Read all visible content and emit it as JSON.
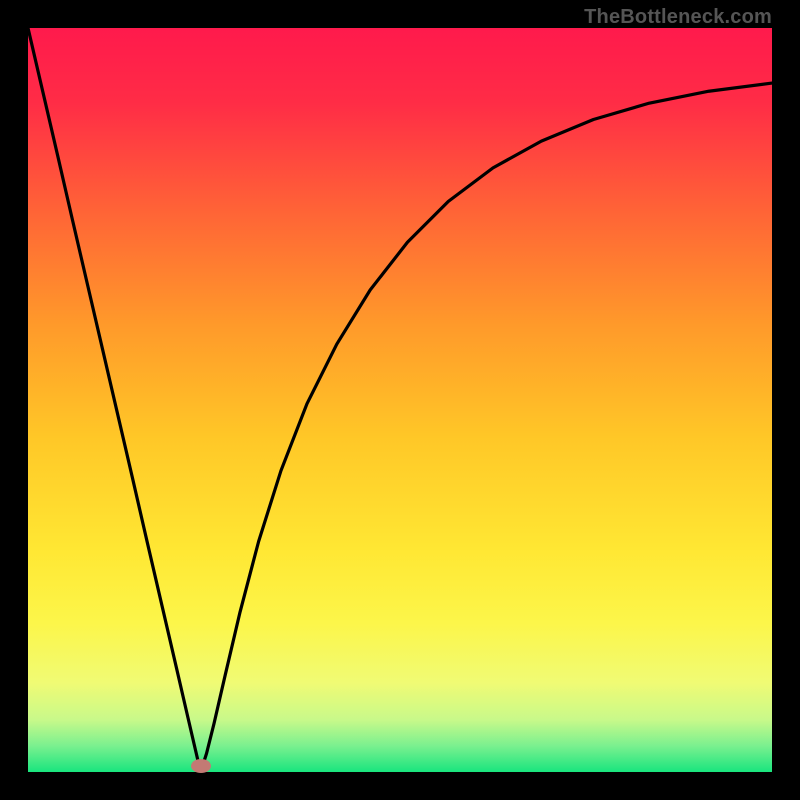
{
  "attribution": "TheBottleneck.com",
  "marker": {
    "color": "#c37a74",
    "x_frac": 0.232,
    "y_frac": 0.992
  },
  "chart_data": {
    "type": "line",
    "title": "",
    "xlabel": "",
    "ylabel": "",
    "xlim": [
      0,
      1
    ],
    "ylim": [
      0,
      1
    ],
    "gradient_stops": [
      {
        "pos": 0.0,
        "color": "#ff1a4c"
      },
      {
        "pos": 0.1,
        "color": "#ff2c46"
      },
      {
        "pos": 0.25,
        "color": "#ff6536"
      },
      {
        "pos": 0.4,
        "color": "#ff9a2a"
      },
      {
        "pos": 0.55,
        "color": "#ffc727"
      },
      {
        "pos": 0.7,
        "color": "#ffe733"
      },
      {
        "pos": 0.8,
        "color": "#fcf64a"
      },
      {
        "pos": 0.88,
        "color": "#f0fb74"
      },
      {
        "pos": 0.93,
        "color": "#c8f98a"
      },
      {
        "pos": 0.965,
        "color": "#7af08f"
      },
      {
        "pos": 1.0,
        "color": "#19e57e"
      }
    ],
    "series": [
      {
        "name": "bottleneck-curve",
        "color": "#000000",
        "x": [
          0.0,
          0.02,
          0.04,
          0.06,
          0.08,
          0.1,
          0.12,
          0.14,
          0.16,
          0.18,
          0.2,
          0.215,
          0.225,
          0.232,
          0.24,
          0.25,
          0.265,
          0.285,
          0.31,
          0.34,
          0.375,
          0.415,
          0.46,
          0.51,
          0.565,
          0.625,
          0.69,
          0.76,
          0.835,
          0.915,
          1.0
        ],
        "y": [
          1.0,
          0.914,
          0.828,
          0.741,
          0.655,
          0.569,
          0.483,
          0.397,
          0.31,
          0.224,
          0.138,
          0.073,
          0.03,
          0.0,
          0.025,
          0.065,
          0.13,
          0.215,
          0.31,
          0.405,
          0.495,
          0.575,
          0.648,
          0.712,
          0.767,
          0.812,
          0.848,
          0.877,
          0.899,
          0.915,
          0.926
        ]
      }
    ],
    "marker_point": {
      "x": 0.232,
      "y": 0.0
    }
  }
}
